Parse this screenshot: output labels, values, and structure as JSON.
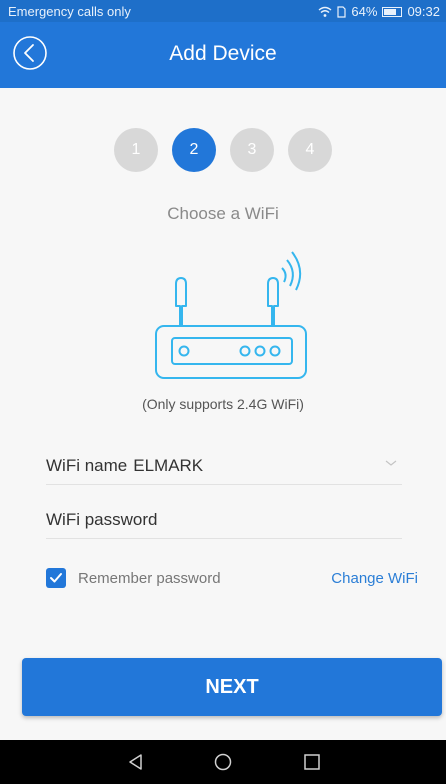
{
  "status_bar": {
    "carrier": "Emergency calls only",
    "battery": "64%",
    "time": "09:32"
  },
  "header": {
    "title": "Add Device"
  },
  "steps": [
    "1",
    "2",
    "3",
    "4"
  ],
  "active_step": 2,
  "main": {
    "title": "Choose a WiFi",
    "note": "(Only supports 2.4G WiFi)"
  },
  "form": {
    "wifi_name_label": "WiFi name",
    "wifi_name_value": "ELMARK",
    "wifi_password_placeholder": "WiFi password",
    "remember_label": "Remember password",
    "remember_checked": true,
    "change_wifi": "Change WiFi"
  },
  "next_label": "NEXT",
  "colors": {
    "primary": "#2277d9",
    "step_inactive": "#d8d8d8",
    "router_stroke": "#35b6ee"
  }
}
